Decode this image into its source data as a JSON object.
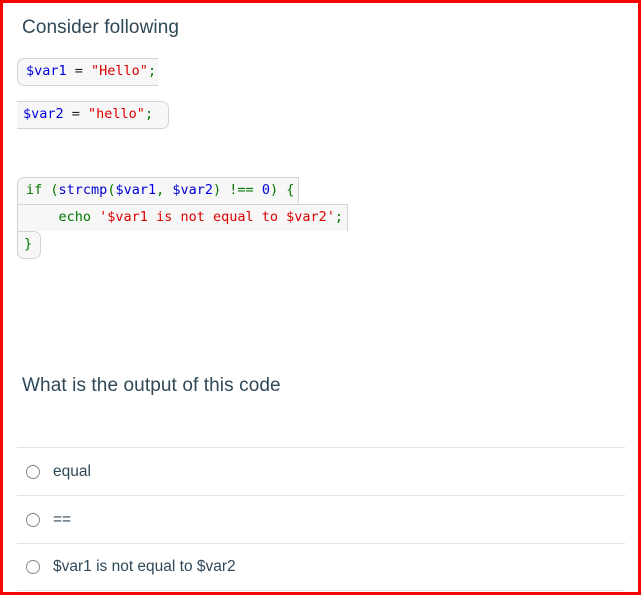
{
  "page": {
    "border_color": "#ff0000",
    "background": "#ffffff"
  },
  "prompt": {
    "title": "Consider following"
  },
  "code_block_1": {
    "language": "php",
    "lines": [
      {
        "id": "line-1",
        "tokens": [
          {
            "text": "$var1",
            "type": "variable"
          },
          {
            "text": " = ",
            "type": "default"
          },
          {
            "text": "\"Hello\"",
            "type": "string"
          },
          {
            "text": ";",
            "type": "punctuation"
          }
        ]
      },
      {
        "id": "line-2",
        "tokens": [
          {
            "text": "$var2",
            "type": "variable"
          },
          {
            "text": " = ",
            "type": "default"
          },
          {
            "text": "\"hello\"",
            "type": "string"
          },
          {
            "text": ";",
            "type": "punctuation"
          }
        ]
      }
    ]
  },
  "code_block_2": {
    "language": "php",
    "lines": [
      {
        "id": "line-if",
        "tokens": [
          {
            "text": "if",
            "type": "keyword"
          },
          {
            "text": " ",
            "type": "default"
          },
          {
            "text": "(",
            "type": "punctuation"
          },
          {
            "text": "strcmp",
            "type": "function"
          },
          {
            "text": "(",
            "type": "punctuation"
          },
          {
            "text": "$var1",
            "type": "variable"
          },
          {
            "text": ", ",
            "type": "punctuation"
          },
          {
            "text": "$var2",
            "type": "variable"
          },
          {
            "text": ")",
            "type": "punctuation"
          },
          {
            "text": " ",
            "type": "default"
          },
          {
            "text": "!==",
            "type": "punctuation"
          },
          {
            "text": " ",
            "type": "default"
          },
          {
            "text": "0",
            "type": "number"
          },
          {
            "text": ")",
            "type": "punctuation"
          },
          {
            "text": " ",
            "type": "default"
          },
          {
            "text": "{",
            "type": "punctuation"
          }
        ]
      },
      {
        "id": "line-echo",
        "tokens": [
          {
            "text": "    ",
            "type": "default"
          },
          {
            "text": "echo",
            "type": "keyword"
          },
          {
            "text": " ",
            "type": "default"
          },
          {
            "text": "'$var1 is not equal to $var2'",
            "type": "string"
          },
          {
            "text": ";",
            "type": "punctuation"
          }
        ]
      },
      {
        "id": "line-close",
        "tokens": [
          {
            "text": "}",
            "type": "punctuation"
          }
        ]
      }
    ]
  },
  "question": {
    "title": "What is the output of this code",
    "options": [
      {
        "id": "opt-1",
        "label": "equal",
        "selected": false
      },
      {
        "id": "opt-2",
        "label": "==",
        "selected": false
      },
      {
        "id": "opt-3",
        "label": "$var1 is not equal to $var2",
        "selected": false
      }
    ]
  },
  "colors": {
    "variable": "#0000dd",
    "string": "#dd0000",
    "punctuation": "#007700",
    "keyword": "#007700",
    "function": "#0000cc",
    "number": "#0000dd",
    "default": "#222222",
    "heading_text": "#2f4858",
    "code_background": "#f7f7f7",
    "code_border": "#d4d4d4",
    "option_divider": "#e2e2e2",
    "radio_border": "#8a8a8a"
  }
}
